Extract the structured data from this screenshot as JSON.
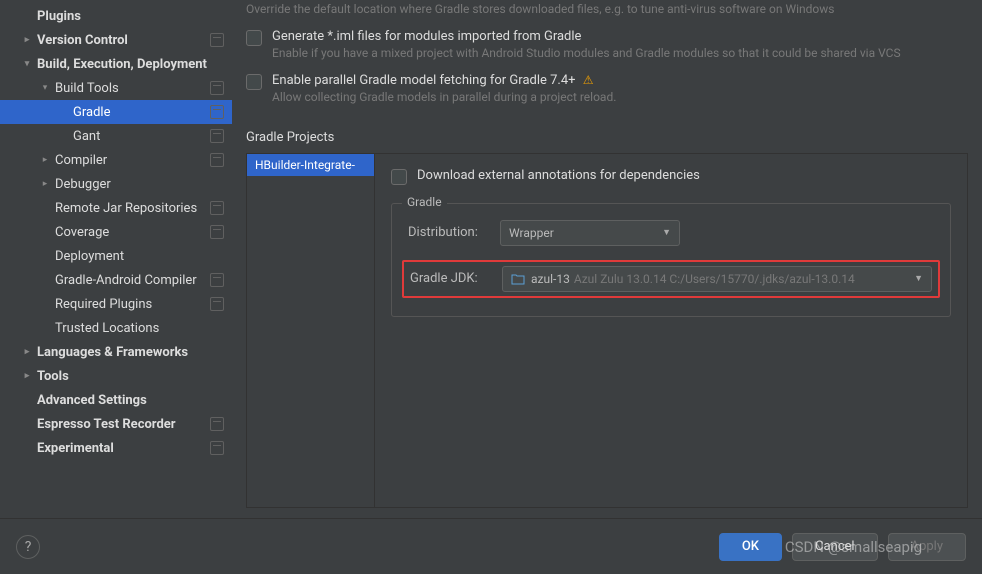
{
  "sidebar": {
    "items": [
      {
        "label": "Plugins",
        "bold": true,
        "indent": 1,
        "chev": "",
        "snap": false
      },
      {
        "label": "Version Control",
        "bold": true,
        "indent": 1,
        "chev": "right",
        "snap": true
      },
      {
        "label": "Build, Execution, Deployment",
        "bold": true,
        "indent": 1,
        "chev": "down",
        "snap": false
      },
      {
        "label": "Build Tools",
        "bold": false,
        "indent": 2,
        "chev": "down",
        "snap": true
      },
      {
        "label": "Gradle",
        "bold": false,
        "indent": 3,
        "chev": "",
        "snap": true,
        "selected": true
      },
      {
        "label": "Gant",
        "bold": false,
        "indent": 3,
        "chev": "",
        "snap": true
      },
      {
        "label": "Compiler",
        "bold": false,
        "indent": 2,
        "chev": "right",
        "snap": true
      },
      {
        "label": "Debugger",
        "bold": false,
        "indent": 2,
        "chev": "right",
        "snap": false
      },
      {
        "label": "Remote Jar Repositories",
        "bold": false,
        "indent": 2,
        "chev": "",
        "snap": true
      },
      {
        "label": "Coverage",
        "bold": false,
        "indent": 2,
        "chev": "",
        "snap": true
      },
      {
        "label": "Deployment",
        "bold": false,
        "indent": 2,
        "chev": "",
        "snap": false
      },
      {
        "label": "Gradle-Android Compiler",
        "bold": false,
        "indent": 2,
        "chev": "",
        "snap": true
      },
      {
        "label": "Required Plugins",
        "bold": false,
        "indent": 2,
        "chev": "",
        "snap": true
      },
      {
        "label": "Trusted Locations",
        "bold": false,
        "indent": 2,
        "chev": "",
        "snap": false
      },
      {
        "label": "Languages & Frameworks",
        "bold": true,
        "indent": 1,
        "chev": "right",
        "snap": false
      },
      {
        "label": "Tools",
        "bold": true,
        "indent": 1,
        "chev": "right",
        "snap": false
      },
      {
        "label": "Advanced Settings",
        "bold": true,
        "indent": 1,
        "chev": "",
        "snap": false
      },
      {
        "label": "Espresso Test Recorder",
        "bold": true,
        "indent": 1,
        "chev": "",
        "snap": true
      },
      {
        "label": "Experimental",
        "bold": true,
        "indent": 1,
        "chev": "",
        "snap": true
      }
    ]
  },
  "main": {
    "topHint": "Override the default location where Gradle stores downloaded files, e.g. to tune anti-virus software on Windows",
    "check1": {
      "label": "Generate *.iml files for modules imported from Gradle",
      "hint": "Enable if you have a mixed project with Android Studio modules and Gradle modules so that it could be shared via VCS"
    },
    "check2": {
      "label": "Enable parallel Gradle model fetching for Gradle 7.4+",
      "hint": "Allow collecting Gradle models in parallel during a project reload."
    },
    "sectionTitle": "Gradle Projects",
    "project": "HBuilder-Integrate-",
    "detail": {
      "downloadLabel": "Download external annotations for dependencies",
      "groupLabel": "Gradle",
      "distribution": {
        "label": "Distribution:",
        "value": "Wrapper"
      },
      "jdk": {
        "label": "Gradle JDK:",
        "value": "azul-13",
        "path": "Azul Zulu 13.0.14 C:/Users/15770/.jdks/azul-13.0.14"
      }
    }
  },
  "buttons": {
    "ok": "OK",
    "cancel": "Cancel",
    "apply": "Apply"
  },
  "watermark": "CSDN @smallseapig"
}
